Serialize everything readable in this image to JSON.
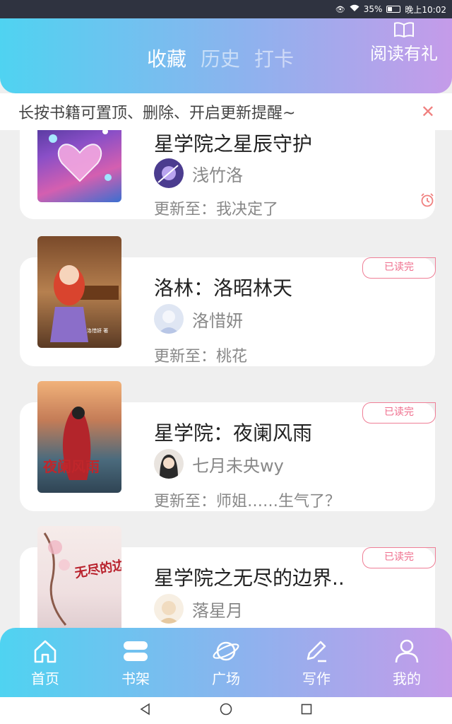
{
  "status_bar": {
    "battery": "35%",
    "time": "晚上10:02"
  },
  "header": {
    "tabs": [
      {
        "label": "收藏",
        "active": true
      },
      {
        "label": "历史",
        "active": false
      },
      {
        "label": "打卡",
        "active": false
      }
    ],
    "gift_label": "阅读有礼",
    "gradient": [
      "#4fd3f1",
      "#c59be9"
    ]
  },
  "notice": {
    "text": "长按书籍可置顶、删除、开启更新提醒~",
    "close_icon": "close-icon"
  },
  "books": [
    {
      "title": "星学院之星辰守护",
      "author": "浅竹洛",
      "update": "更新至：我决定了",
      "badge": "",
      "alarm": true
    },
    {
      "title": "洛林：洛昭林天",
      "author": "洛惜妍",
      "update": "更新至：桃花",
      "badge": "已读完",
      "cover_text": "洛惜妍 著"
    },
    {
      "title": "星学院：夜阑风雨",
      "author": "七月未央wy",
      "update": "更新至：师姐……生气了？",
      "badge": "已读完",
      "cover_text": "夜阑风雨"
    },
    {
      "title": "星学院之无尽的边界..",
      "author": "落星月",
      "update": "",
      "badge": "已读完",
      "cover_text": "无尽的边界"
    }
  ],
  "bottom_nav": [
    {
      "label": "首页",
      "icon": "home-icon"
    },
    {
      "label": "书架",
      "icon": "bookshelf-icon",
      "active": true
    },
    {
      "label": "广场",
      "icon": "planet-icon"
    },
    {
      "label": "写作",
      "icon": "pen-icon"
    },
    {
      "label": "我的",
      "icon": "user-icon"
    }
  ],
  "colors": {
    "badge": "#ef7e96",
    "close": "#f0807f"
  }
}
